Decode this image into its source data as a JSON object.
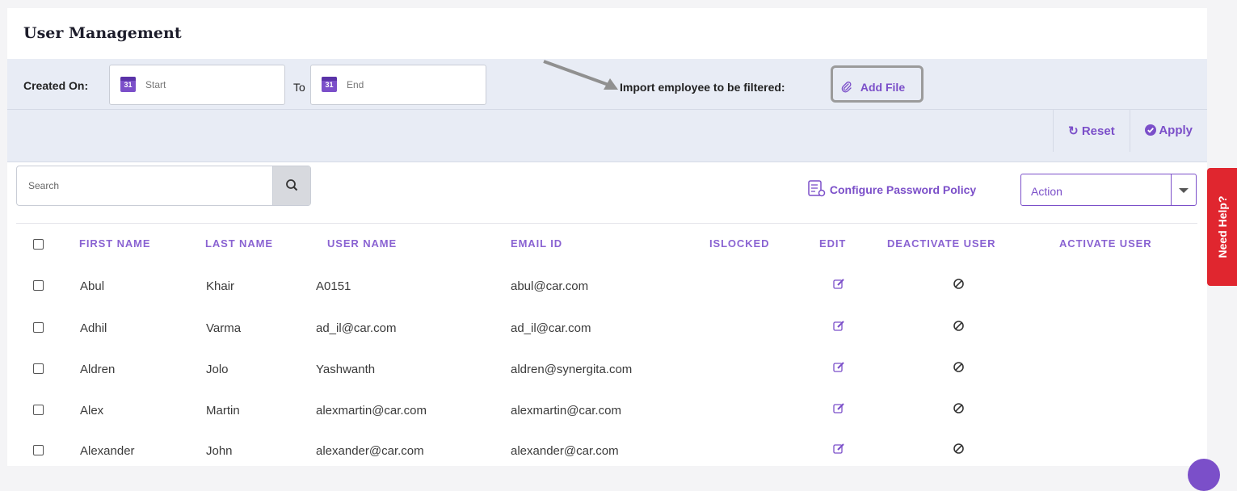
{
  "page": {
    "title": "User Management"
  },
  "filters": {
    "created_on_label": "Created On:",
    "start_placeholder": "Start",
    "to_label": "To",
    "end_placeholder": "End",
    "calendar_day": "31",
    "import_label": "Import employee to be filtered:",
    "add_file_label": "Add File",
    "reset_label": "Reset",
    "apply_label": "Apply"
  },
  "toolbar": {
    "search_placeholder": "Search",
    "configure_label": "Configure Password Policy",
    "action_value": "Action"
  },
  "table": {
    "headers": {
      "first_name": "FIRST NAME",
      "last_name": "LAST NAME",
      "user_name": "USER NAME",
      "email_id": "EMAIL ID",
      "islocked": "ISLOCKED",
      "edit": "EDIT",
      "deactivate": "DEACTIVATE USER",
      "activate": "ACTIVATE USER"
    },
    "rows": [
      {
        "first": "Abul",
        "last": "Khair",
        "user": "A0151",
        "email": "abul@car.com"
      },
      {
        "first": "Adhil",
        "last": "Varma",
        "user": "ad_il@car.com",
        "email": "ad_il@car.com"
      },
      {
        "first": "Aldren",
        "last": "Jolo",
        "user": "Yashwanth",
        "email": "aldren@synergita.com"
      },
      {
        "first": "Alex",
        "last": "Martin",
        "user": "alexmartin@car.com",
        "email": "alexmartin@car.com"
      },
      {
        "first": "Alexander",
        "last": "John",
        "user": "alexander@car.com",
        "email": "alexander@car.com"
      }
    ]
  },
  "help": {
    "label": "Need Help?"
  },
  "colors": {
    "accent": "#7b4fc9",
    "help": "#e0262f",
    "filter_bg": "#e8ecf5"
  }
}
